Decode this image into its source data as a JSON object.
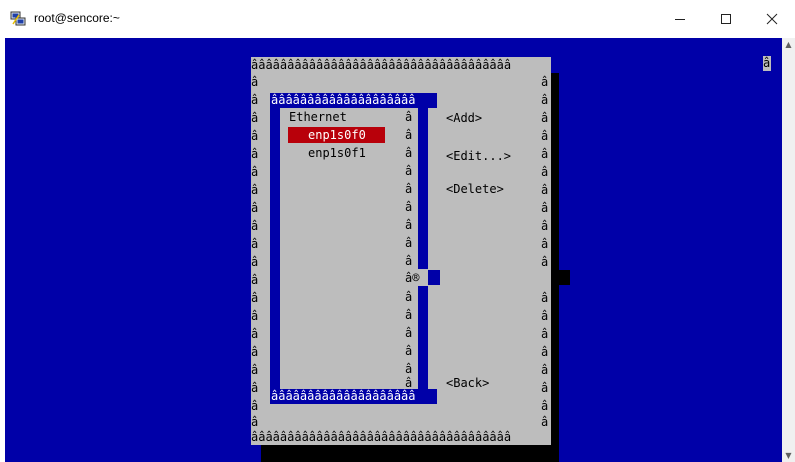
{
  "window": {
    "title": "root@sencore:~",
    "minimize_glyph": "—",
    "maximize_glyph": "☐",
    "close_glyph": "✕"
  },
  "scrollbar": {
    "up_glyph": "▲",
    "down_glyph": "▼"
  },
  "tui": {
    "border_char": "â",
    "outer_top_border": "ââââââââââââââââââââââââââââââââââââ",
    "outer_bottom_border": "ââââââââââââââââââââââââââââââââââââ",
    "list_top_border": "ââââââââââââââââââââ",
    "list_bottom_border": "ââââââââââââââââââââ",
    "list": {
      "heading": "Ethernet",
      "items": [
        "enp1s0f0",
        "enp1s0f1"
      ],
      "selected_index": 0,
      "scroll_thumb": "â®"
    },
    "buttons": {
      "add": "<Add>",
      "edit": "<Edit...>",
      "delete": "<Delete>",
      "back": "<Back>"
    },
    "right_edge_char": "â",
    "stray_char": "â"
  },
  "colors": {
    "terminal_bg": "#0000a8",
    "dialog_bg": "#bdbdbd",
    "selection_bg": "#b8000a"
  }
}
